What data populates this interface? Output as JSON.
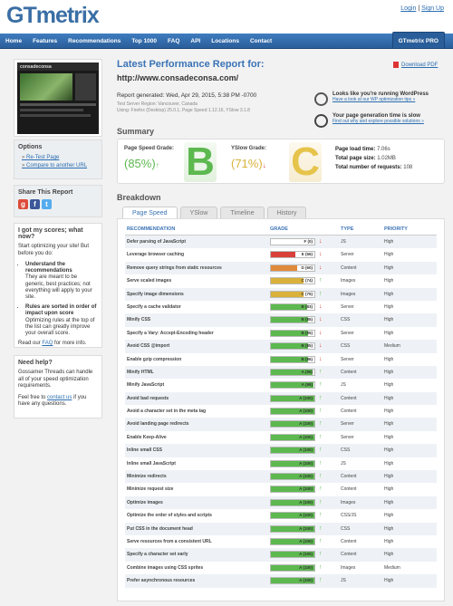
{
  "header": {
    "logo": "GTmetrix",
    "login": "Login",
    "separator": "|",
    "signup": "Sign Up"
  },
  "nav": {
    "items": [
      "Home",
      "Features",
      "Recommendations",
      "Top 1000",
      "FAQ",
      "API",
      "Locations",
      "Contact"
    ],
    "pro": "GTmetrix PRO"
  },
  "sidebar": {
    "thumb_caption": "consadeconsa",
    "options_title": "Options",
    "options": [
      "Re-Test Page",
      "Compare to another URL"
    ],
    "share_title": "Share This Report",
    "got_title": "I got my scores; what now?",
    "got_intro": "Start optimizing your site! But before you do:",
    "tip1_title": "Understand the recommendations",
    "tip1_body": "They are meant to be generic, best practices; not everything will apply to your site.",
    "tip2_title": "Rules are sorted in order of impact upon score",
    "tip2_body": "Optimizing rules at the top of the list can greatly improve your overall score.",
    "read_pre": "Read our",
    "read_link": "FAQ",
    "read_post": "for more info.",
    "help_title": "Need help?",
    "help_body": "Gossamer Threads can handle all of your speed optimization requirements.",
    "help_pre": "Feel free to",
    "help_link": "contact us",
    "help_post": "if you have any questions."
  },
  "report": {
    "title": "Latest Performance Report for:",
    "url": "http://www.consadeconsa.com/",
    "pdf": "Download PDF",
    "generated": "Report generated: Wed, Apr 29, 2015, 5:38 PM -0700",
    "region": "Test Server Region: Vancouver, Canada",
    "using": "Using: Firefox (Desktop) 25.0.1, Page Speed 1.12.16, YSlow 3.1.8",
    "wp_title": "Looks like you're running WordPress",
    "wp_link": "Have a look at our WP optimization tips »",
    "slow_title": "Your page generation time is slow",
    "slow_link": "Find out why and explore possible solutions »"
  },
  "summary": {
    "heading": "Summary",
    "ps_label": "Page Speed Grade:",
    "ps_value": "(85%)",
    "ps_letter": "B",
    "ys_label": "YSlow Grade:",
    "ys_value": "(71%)",
    "ys_letter": "C",
    "load_label": "Page load time:",
    "load_value": "7.06s",
    "size_label": "Total page size:",
    "size_value": "1.02MB",
    "req_label": "Total number of requests:",
    "req_value": "108"
  },
  "breakdown": {
    "heading": "Breakdown",
    "tabs": [
      "Page Speed",
      "YSlow",
      "Timeline",
      "History"
    ],
    "columns": [
      "RECOMMENDATION",
      "GRADE",
      "TYPE",
      "PRIORITY"
    ],
    "colors": {
      "red": "#d9403a",
      "orange": "#e08a3b",
      "yellow": "#d9b13b",
      "green": "#5cb84f"
    },
    "rows": [
      {
        "name": "Defer parsing of JavaScript",
        "grade": "F (0)",
        "score": 0,
        "color": "red",
        "dir": "down",
        "type": "JS",
        "priority": "High"
      },
      {
        "name": "Leverage browser caching",
        "grade": "E (56)",
        "score": 56,
        "color": "red",
        "dir": "down",
        "type": "Server",
        "priority": "High"
      },
      {
        "name": "Remove query strings from static resources",
        "grade": "D (60)",
        "score": 60,
        "color": "orange",
        "dir": "down",
        "type": "Content",
        "priority": "High"
      },
      {
        "name": "Serve scaled images",
        "grade": "C (74)",
        "score": 74,
        "color": "yellow",
        "dir": "up",
        "type": "Images",
        "priority": "High"
      },
      {
        "name": "Specify image dimensions",
        "grade": "C (75)",
        "score": 75,
        "color": "yellow",
        "dir": "up",
        "type": "Images",
        "priority": "High"
      },
      {
        "name": "Specify a cache validator",
        "grade": "B (83)",
        "score": 83,
        "color": "green",
        "dir": "down",
        "type": "Server",
        "priority": "High"
      },
      {
        "name": "Minify CSS",
        "grade": "B (85)",
        "score": 85,
        "color": "green",
        "dir": "down",
        "type": "CSS",
        "priority": "High"
      },
      {
        "name": "Specify a Vary: Accept-Encoding header",
        "grade": "B (85)",
        "score": 85,
        "color": "green",
        "dir": "down",
        "type": "Server",
        "priority": "High"
      },
      {
        "name": "Avoid CSS @import",
        "grade": "B (85)",
        "score": 85,
        "color": "green",
        "dir": "down",
        "type": "CSS",
        "priority": "Medium"
      },
      {
        "name": "Enable gzip compression",
        "grade": "B (86)",
        "score": 86,
        "color": "green",
        "dir": "down",
        "type": "Server",
        "priority": "High"
      },
      {
        "name": "Minify HTML",
        "grade": "A (96)",
        "score": 96,
        "color": "green",
        "dir": "up",
        "type": "Content",
        "priority": "High"
      },
      {
        "name": "Minify JavaScript",
        "grade": "A (98)",
        "score": 98,
        "color": "green",
        "dir": "up",
        "type": "JS",
        "priority": "High"
      },
      {
        "name": "Avoid bad requests",
        "grade": "A (100)",
        "score": 100,
        "color": "green",
        "dir": "up",
        "type": "Content",
        "priority": "High"
      },
      {
        "name": "Avoid a character set in the meta tag",
        "grade": "A (100)",
        "score": 100,
        "color": "green",
        "dir": "up",
        "type": "Content",
        "priority": "High"
      },
      {
        "name": "Avoid landing page redirects",
        "grade": "A (100)",
        "score": 100,
        "color": "green",
        "dir": "up",
        "type": "Server",
        "priority": "High"
      },
      {
        "name": "Enable Keep-Alive",
        "grade": "A (100)",
        "score": 100,
        "color": "green",
        "dir": "up",
        "type": "Server",
        "priority": "High"
      },
      {
        "name": "Inline small CSS",
        "grade": "A (100)",
        "score": 100,
        "color": "green",
        "dir": "up",
        "type": "CSS",
        "priority": "High"
      },
      {
        "name": "Inline small JavaScript",
        "grade": "A (100)",
        "score": 100,
        "color": "green",
        "dir": "up",
        "type": "JS",
        "priority": "High"
      },
      {
        "name": "Minimize redirects",
        "grade": "A (100)",
        "score": 100,
        "color": "green",
        "dir": "up",
        "type": "Content",
        "priority": "High"
      },
      {
        "name": "Minimize request size",
        "grade": "A (100)",
        "score": 100,
        "color": "green",
        "dir": "up",
        "type": "Content",
        "priority": "High"
      },
      {
        "name": "Optimize images",
        "grade": "A (100)",
        "score": 100,
        "color": "green",
        "dir": "up",
        "type": "Images",
        "priority": "High"
      },
      {
        "name": "Optimize the order of styles and scripts",
        "grade": "A (100)",
        "score": 100,
        "color": "green",
        "dir": "up",
        "type": "CSS/JS",
        "priority": "High"
      },
      {
        "name": "Put CSS in the document head",
        "grade": "A (100)",
        "score": 100,
        "color": "green",
        "dir": "up",
        "type": "CSS",
        "priority": "High"
      },
      {
        "name": "Serve resources from a consistent URL",
        "grade": "A (100)",
        "score": 100,
        "color": "green",
        "dir": "up",
        "type": "Content",
        "priority": "High"
      },
      {
        "name": "Specify a character set early",
        "grade": "A (100)",
        "score": 100,
        "color": "green",
        "dir": "up",
        "type": "Content",
        "priority": "High"
      },
      {
        "name": "Combine images using CSS sprites",
        "grade": "A (100)",
        "score": 100,
        "color": "green",
        "dir": "up",
        "type": "Images",
        "priority": "Medium"
      },
      {
        "name": "Prefer asynchronous resources",
        "grade": "A (100)",
        "score": 100,
        "color": "green",
        "dir": "up",
        "type": "JS",
        "priority": "High"
      }
    ]
  }
}
